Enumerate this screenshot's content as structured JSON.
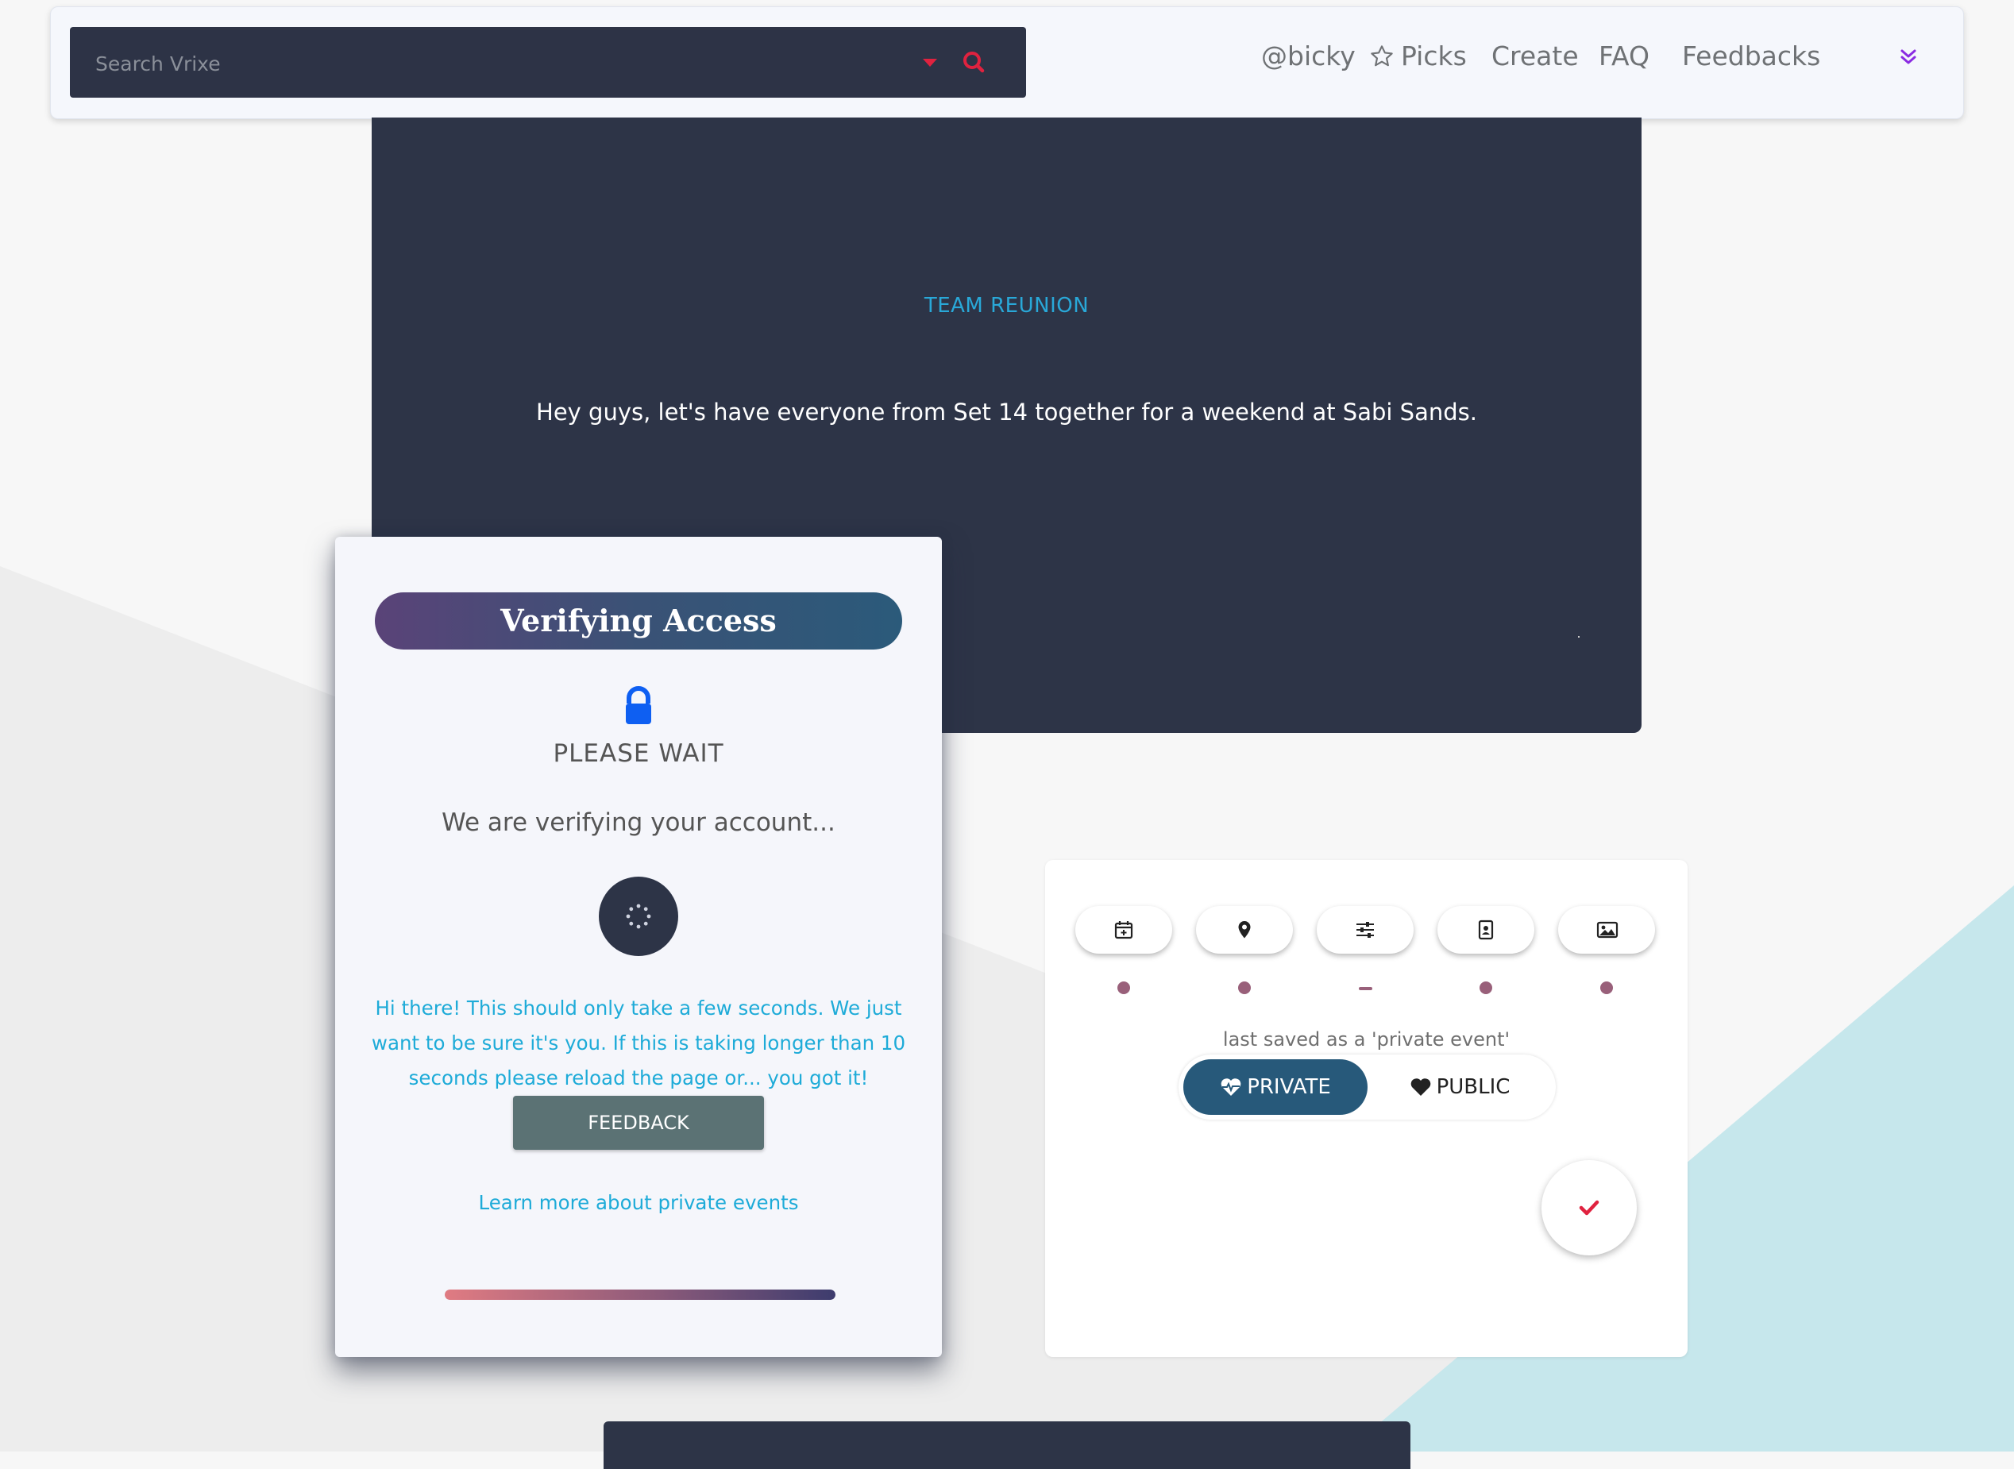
{
  "search": {
    "placeholder": "Search Vrixe"
  },
  "nav": {
    "user": "@bicky",
    "picks": "Picks",
    "create": "Create",
    "faq": "FAQ",
    "feedbacks": "Feedbacks"
  },
  "event": {
    "title": "TEAM REUNION",
    "description": "Hey guys, let's have everyone from Set 14 together for a weekend at Sabi Sands."
  },
  "modal": {
    "title": "Verifying Access",
    "status": "PLEASE WAIT",
    "message": "We are verifying your account...",
    "note": "Hi there! This should only take a few seconds. We just want to be sure it's you. If this is taking longer than 10 seconds please reload the page or... you got it!",
    "feedback_label": "FEEDBACK",
    "learn_more": "Learn more about private events",
    "progress": 1.0
  },
  "editor": {
    "steps": [
      {
        "icon": "calendar-icon",
        "state": "dot"
      },
      {
        "icon": "map-pin-icon",
        "state": "dot"
      },
      {
        "icon": "sliders-icon",
        "state": "dash"
      },
      {
        "icon": "contact-card-icon",
        "state": "dot"
      },
      {
        "icon": "image-icon",
        "state": "dot"
      }
    ],
    "saved_text": "last saved as a 'private event'",
    "private_label": "PRIVATE",
    "public_label": "PUBLIC",
    "selected": "PRIVATE"
  },
  "colors": {
    "accent_red": "#e0223f",
    "link_blue": "#1eabd8",
    "dark_panel": "#2d3447",
    "toggle_active": "#27597a",
    "step_dot": "#99607a"
  }
}
